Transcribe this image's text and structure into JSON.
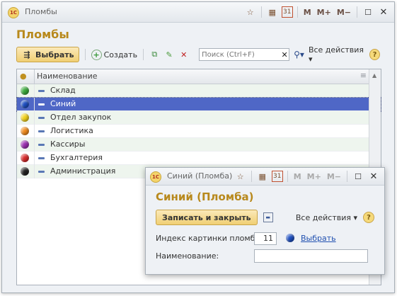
{
  "main_window": {
    "title": "Пломбы",
    "form_title": "Пломбы",
    "toolbar": {
      "choose_label": "Выбрать",
      "create_label": "Создать",
      "search_placeholder": "Поиск (Ctrl+F)",
      "all_actions_label": "Все действия ▾",
      "help_label": "?"
    },
    "title_buttons": [
      "M",
      "M+",
      "M−"
    ],
    "calendar_day": "31",
    "grid": {
      "column_name": "Наименование",
      "rows": [
        {
          "name": "Склад",
          "color": "#3aa83a"
        },
        {
          "name": "Синий",
          "color": "#1e4fc0",
          "selected": true
        },
        {
          "name": "Отдел закупок",
          "color": "#f2d21c"
        },
        {
          "name": "Логистика",
          "color": "#f08a1c"
        },
        {
          "name": "Кассиры",
          "color": "#9a2fb0"
        },
        {
          "name": "Бухгалтерия",
          "color": "#d82a2a"
        },
        {
          "name": "Администрация",
          "color": "#222222"
        }
      ]
    }
  },
  "popup_window": {
    "title": "Синий (Пломба)",
    "form_title": "Синий (Пломба)",
    "save_close_label": "Записать и закрыть",
    "all_actions_label": "Все действия ▾",
    "help_label": "?",
    "title_buttons": [
      "M",
      "M+",
      "M−"
    ],
    "calendar_day": "31",
    "fields": {
      "picture_index_label": "Индекс картинки пломбы:",
      "picture_index_value": "11",
      "choose_link": "Выбрать",
      "name_label": "Наименование:",
      "name_value": ""
    }
  }
}
